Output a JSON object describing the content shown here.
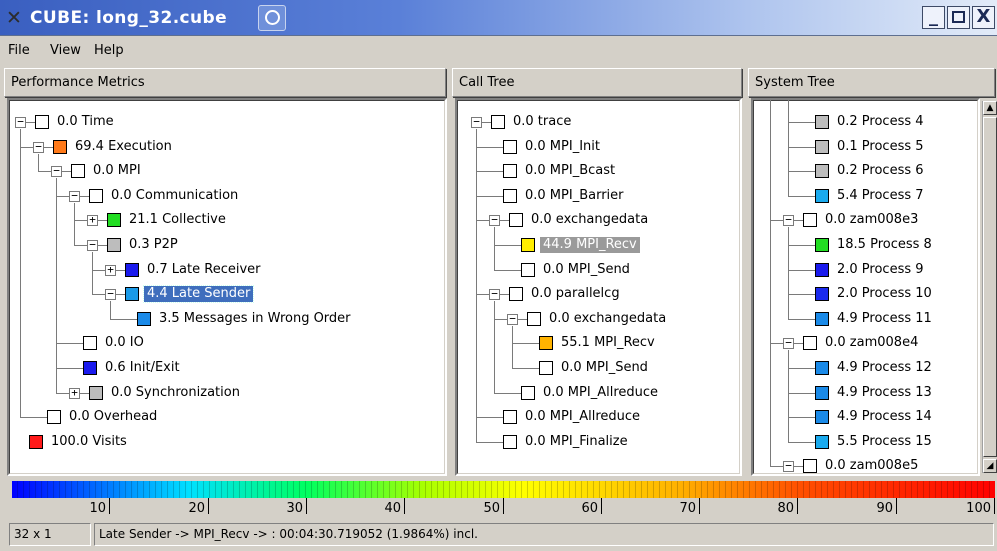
{
  "window": {
    "title": "CUBE:  long_32.cube",
    "close_symbol": "X",
    "minimize_symbol": "_"
  },
  "menu": {
    "file": "File",
    "view": "View",
    "help": "Help"
  },
  "panels": {
    "metrics_header": "Performance Metrics",
    "calltree_header": "Call Tree",
    "systemtree_header": "System Tree"
  },
  "metrics_tree": [
    {
      "label": "0.0 Time",
      "color": "#ffffff",
      "expander": "−"
    },
    {
      "label": "69.4 Execution",
      "color": "#ff7a1a",
      "expander": "−"
    },
    {
      "label": "0.0 MPI",
      "color": "#ffffff",
      "expander": "−"
    },
    {
      "label": "0.0 Communication",
      "color": "#ffffff",
      "expander": "−"
    },
    {
      "label": "21.1 Collective",
      "color": "#22dd22",
      "expander": "+"
    },
    {
      "label": "0.3 P2P",
      "color": "#bdbdbd",
      "expander": "−"
    },
    {
      "label": "0.7 Late Receiver",
      "color": "#1a1aee",
      "expander": "+"
    },
    {
      "label": "4.4 Late Sender",
      "color": "#1a9ae8",
      "expander": "−",
      "selected": true
    },
    {
      "label": "3.5 Messages in Wrong Order",
      "color": "#1a8ae8"
    },
    {
      "label": "0.0 IO",
      "color": "#ffffff"
    },
    {
      "label": "0.6 Init/Exit",
      "color": "#1a1aee"
    },
    {
      "label": "0.0 Synchronization",
      "color": "#bdbdbd",
      "expander": "+"
    },
    {
      "label": "0.0 Overhead",
      "color": "#ffffff"
    },
    {
      "label": "100.0 Visits",
      "color": "#ff1a1a"
    }
  ],
  "call_tree": [
    {
      "label": "0.0 trace",
      "color": "#ffffff",
      "expander": "−"
    },
    {
      "label": "0.0 MPI_Init",
      "color": "#ffffff"
    },
    {
      "label": "0.0 MPI_Bcast",
      "color": "#ffffff"
    },
    {
      "label": "0.0 MPI_Barrier",
      "color": "#ffffff"
    },
    {
      "label": "0.0 exchangedata",
      "color": "#ffffff",
      "expander": "−"
    },
    {
      "label": "44.9 MPI_Recv",
      "color": "#ffee00",
      "highlight": true
    },
    {
      "label": "0.0 MPI_Send",
      "color": "#ffffff"
    },
    {
      "label": "0.0 parallelcg",
      "color": "#ffffff",
      "expander": "−"
    },
    {
      "label": "0.0 exchangedata",
      "color": "#ffffff",
      "expander": "−"
    },
    {
      "label": "55.1 MPI_Recv",
      "color": "#ffb300"
    },
    {
      "label": "0.0 MPI_Send",
      "color": "#ffffff"
    },
    {
      "label": "0.0 MPI_Allreduce",
      "color": "#ffffff"
    },
    {
      "label": "0.0 MPI_Allreduce",
      "color": "#ffffff"
    },
    {
      "label": "0.0 MPI_Finalize",
      "color": "#ffffff"
    }
  ],
  "system_tree": [
    {
      "label": "0.2 Process 4",
      "color": "#bdbdbd"
    },
    {
      "label": "0.1 Process 5",
      "color": "#bdbdbd"
    },
    {
      "label": "0.2 Process 6",
      "color": "#bdbdbd"
    },
    {
      "label": "5.4 Process 7",
      "color": "#1aaaee"
    },
    {
      "label": "0.0 zam008e3",
      "color": "#ffffff",
      "expander": "−"
    },
    {
      "label": "18.5 Process 8",
      "color": "#22dd22"
    },
    {
      "label": "2.0 Process 9",
      "color": "#1a1aee"
    },
    {
      "label": "2.0 Process 10",
      "color": "#1a2aee"
    },
    {
      "label": "4.9 Process 11",
      "color": "#1a8ae8"
    },
    {
      "label": "0.0 zam008e4",
      "color": "#ffffff",
      "expander": "−"
    },
    {
      "label": "4.9 Process 12",
      "color": "#1a8ae8"
    },
    {
      "label": "4.9 Process 13",
      "color": "#1a8ae8"
    },
    {
      "label": "4.9 Process 14",
      "color": "#1a8ae8"
    },
    {
      "label": "5.5 Process 15",
      "color": "#1aaaee"
    },
    {
      "label": "0.0 zam008e5",
      "color": "#ffffff",
      "expander": "−"
    }
  ],
  "scale": {
    "ticks": [
      "10",
      "20",
      "30",
      "40",
      "50",
      "60",
      "70",
      "80",
      "90",
      "100"
    ]
  },
  "status": {
    "dims": "32 x 1",
    "message": "Late Sender -> MPI_Recv -> :  00:04:30.719052 (1.9864%)  incl."
  },
  "scroll_arrows": {
    "up": "▲",
    "down": "◢"
  }
}
